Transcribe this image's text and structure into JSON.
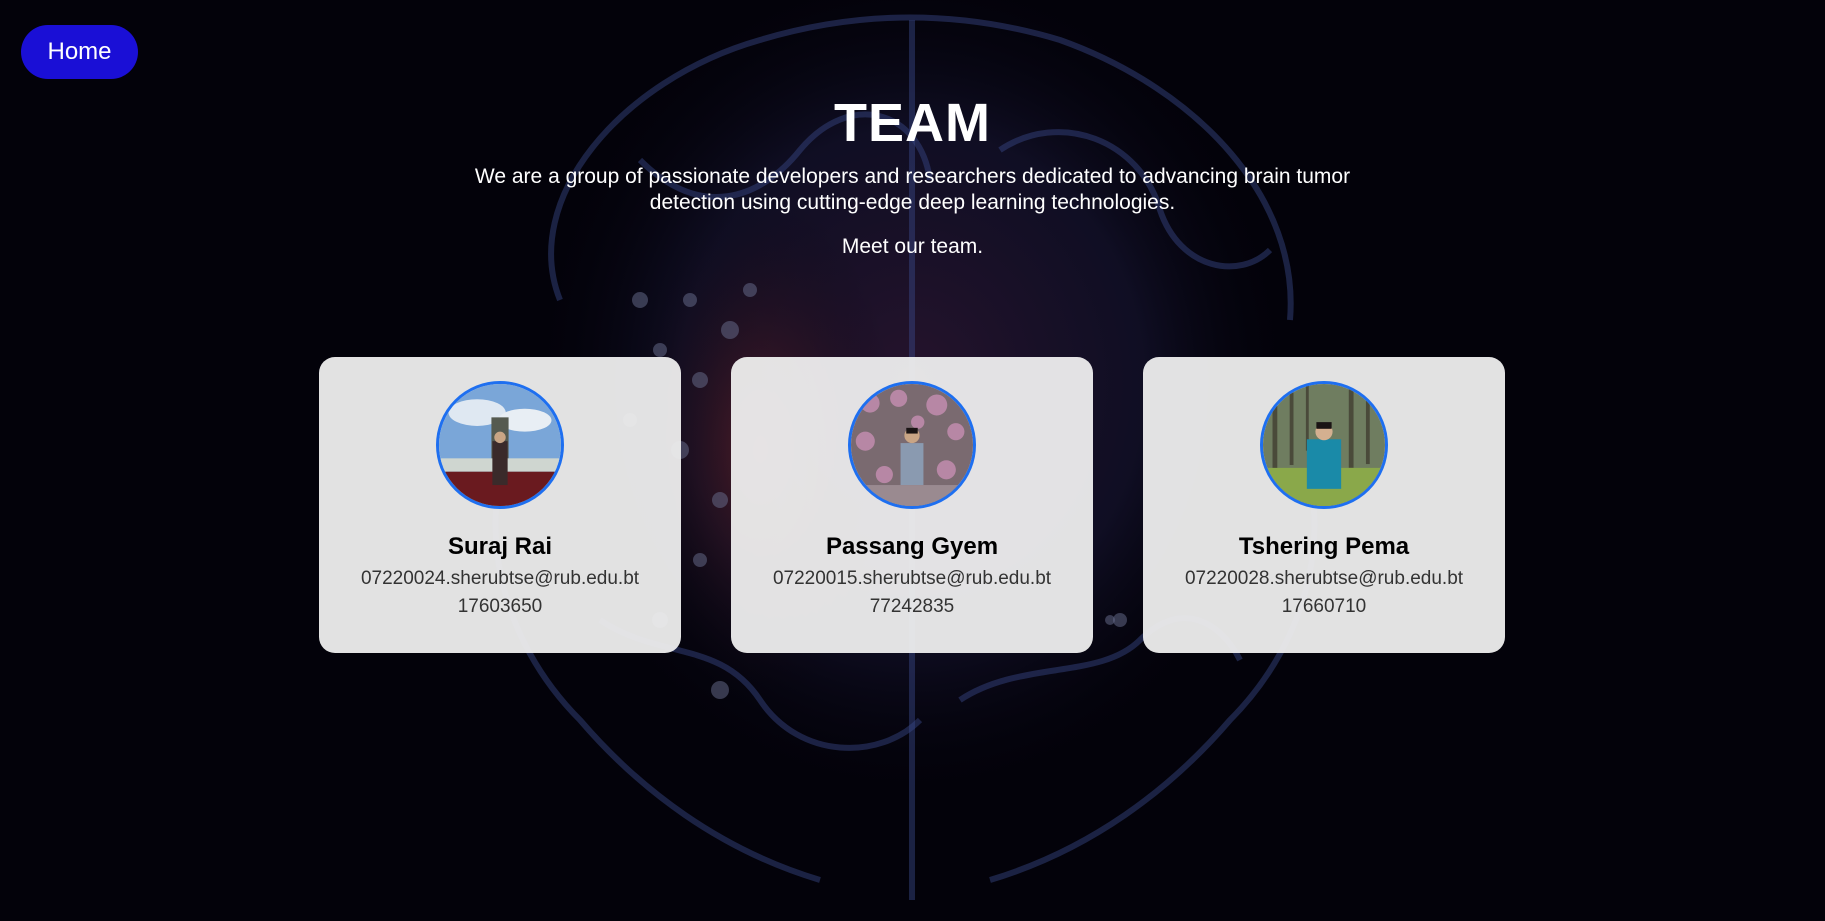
{
  "nav": {
    "home_label": "Home"
  },
  "header": {
    "title": "TEAM",
    "intro": "We are a group of passionate developers and researchers dedicated to advancing brain tumor detection using cutting-edge deep learning technologies.",
    "meet": "Meet our team."
  },
  "team": [
    {
      "name": "Suraj Rai",
      "email": "07220024.sherubtse@rub.edu.bt",
      "phone": "17603650"
    },
    {
      "name": "Passang Gyem",
      "email": "07220015.sherubtse@rub.edu.bt",
      "phone": "77242835"
    },
    {
      "name": "Tshering Pema",
      "email": "07220028.sherubtse@rub.edu.bt",
      "phone": "17660710"
    }
  ],
  "colors": {
    "background": "#03020a",
    "home_button": "#1a0fd6",
    "card": "#eeeeee",
    "avatar_border": "#1e6ff0"
  }
}
